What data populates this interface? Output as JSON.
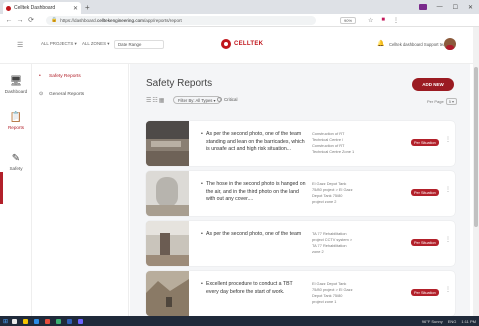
{
  "browser": {
    "tab_title": "Celltek Dashboard",
    "url_prefix": "https://dashboard.",
    "url_domain": "celltekengineering.com",
    "url_path": "/app/reports/report",
    "zoom": "90%"
  },
  "header": {
    "all_projects": "ALL PROJECTS ▾",
    "all_zones": "ALL ZONES ▾",
    "date_range_placeholder": "Date Range",
    "logo_text": "CELLTEK",
    "user_name": "Celltek dashboard Support team"
  },
  "rail": [
    {
      "label": "Dashboard",
      "icon": "monitor-icon"
    },
    {
      "label": "Reports",
      "icon": "clipboard-icon"
    },
    {
      "label": "Safety",
      "icon": "compass-icon"
    }
  ],
  "subnav": [
    {
      "label": "Safety Reports"
    },
    {
      "label": "General Reports"
    }
  ],
  "page": {
    "title": "Safety Reports",
    "add_new": "ADD NEW",
    "filter_label": "Filter By: All Types ▾",
    "critical_label": "Critical",
    "per_page_label": "Per Page",
    "per_page_value": "5 ▾"
  },
  "reports": [
    {
      "desc": "As per the second photo, one of the team standing and lean on the barricades, which is unsafe act and high risk situation...",
      "meta": [
        "Construction of RT",
        "Technical Centre /",
        "Construction of RT",
        "Technical Centre Zone 1"
      ],
      "status": "Per Situation"
    },
    {
      "desc": "The hose in the second photo is hanged on the air, and in the third photo on the land with out any cover....",
      "meta": [
        "El Gazz Depot Tank",
        "75/80 project > El Gazz",
        "Depot Tank 75/80",
        "project zone 2"
      ],
      "status": "Per Situation"
    },
    {
      "desc": "As per the second photo, one of the team",
      "meta": [
        "TA 77 Rehabilitation",
        "project CCTV system >",
        "TA 77 Rehabilitation",
        "zone 2"
      ],
      "status": "Per Situation"
    },
    {
      "desc": "Excellent procedure to conduct a TBT every day before the start of work.",
      "meta": [
        "El Gazz Depot Tank",
        "75/80 project > El Gazz",
        "Depot Tank 75/80",
        "project zone 1"
      ],
      "status": "Per Situation"
    }
  ],
  "taskbar": {
    "weather": "96°F Sunny",
    "lang": "ENG",
    "time": "1:11 PM"
  }
}
